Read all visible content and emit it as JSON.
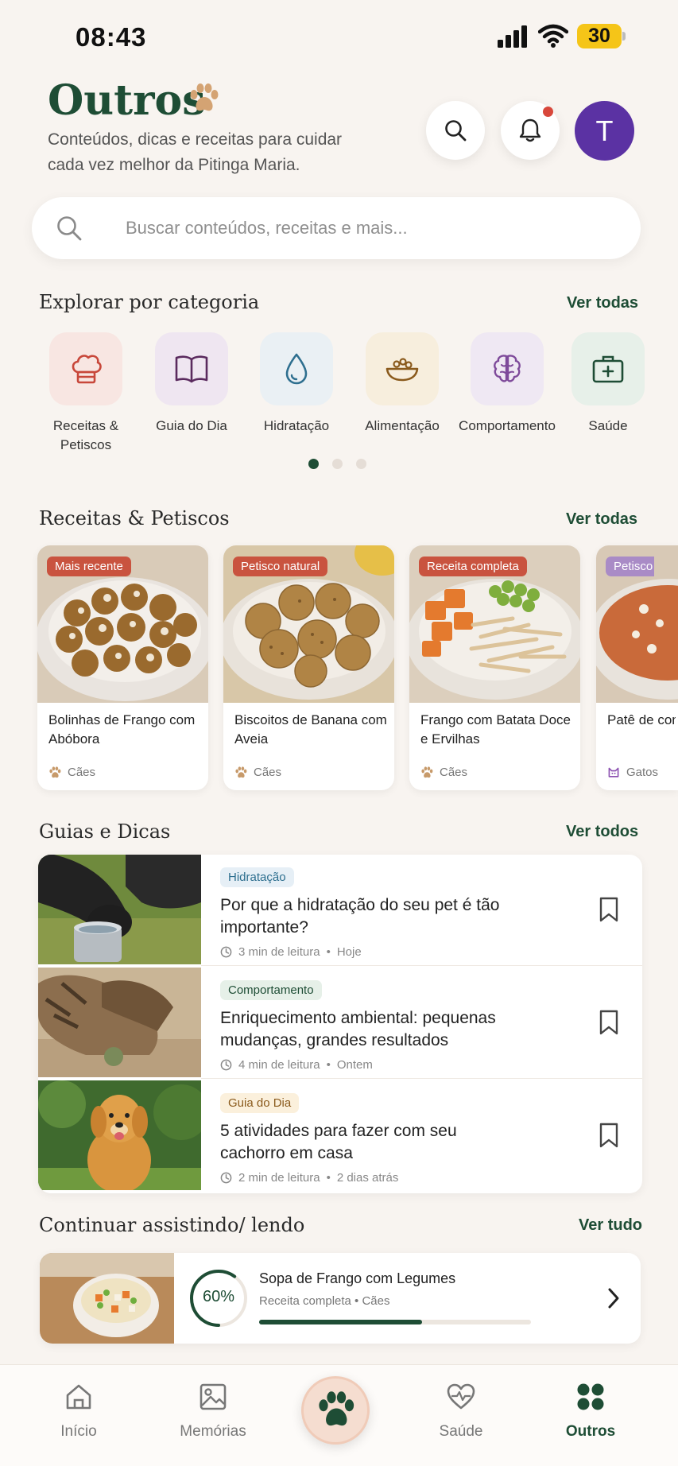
{
  "status": {
    "time": "08:43",
    "battery": "30"
  },
  "header": {
    "title": "Outros",
    "subtitle": "Conteúdos, dicas e receitas para cuidar cada vez melhor da Pitinga Maria.",
    "avatar_letter": "T"
  },
  "search": {
    "placeholder": "Buscar conteúdos, receitas e mais..."
  },
  "categories": {
    "title": "Explorar por categoria",
    "link": "Ver todas",
    "items": [
      {
        "label": "Receitas & Petiscos",
        "icon": "chef-hat-icon"
      },
      {
        "label": "Guia do Dia",
        "icon": "book-icon"
      },
      {
        "label": "Hidratação",
        "icon": "water-drop-icon"
      },
      {
        "label": "Alimentação",
        "icon": "food-bowl-icon"
      },
      {
        "label": "Comportamento",
        "icon": "brain-icon"
      },
      {
        "label": "Saúde",
        "icon": "medical-kit-icon"
      }
    ],
    "page_count": 3,
    "active_page": 1
  },
  "recipes": {
    "title": "Receitas & Petiscos",
    "link": "Ver todas",
    "items": [
      {
        "badge": "Mais recente",
        "name": "Bolinhas de Frango com Abóbora",
        "pet": "Cães"
      },
      {
        "badge": "Petisco natural",
        "name": "Biscoitos de Banana com Aveia",
        "pet": "Cães"
      },
      {
        "badge": "Receita completa",
        "name": "Frango com Batata Doce e Ervilhas",
        "pet": "Cães"
      },
      {
        "badge": "Petisco",
        "name": "Patê de com At",
        "pet": "Gatos"
      }
    ]
  },
  "guides": {
    "title": "Guias e Dicas",
    "link": "Ver todos",
    "items": [
      {
        "tag": "Hidratação",
        "title": "Por que a hidratação do seu pet é tão importante?",
        "read": "3 min de leitura",
        "when": "Hoje"
      },
      {
        "tag": "Comportamento",
        "title": "Enriquecimento ambiental: pequenas mudanças, grandes resultados",
        "read": "4 min de leitura",
        "when": "Ontem"
      },
      {
        "tag": "Guia do Dia",
        "title": "5 atividades para fazer com seu cachorro em casa",
        "read": "2 min de leitura",
        "when": "2 dias atrás"
      }
    ]
  },
  "continue": {
    "title": "Continuar assistindo/ lendo",
    "link": "Ver tudo",
    "item": {
      "title": "Sopa de Frango com Legumes",
      "subtitle": "Receita completa • Cães",
      "progress_label": "60%",
      "progress": 0.6
    }
  },
  "nav": {
    "items": [
      {
        "label": "Início",
        "icon": "home-icon"
      },
      {
        "label": "Memórias",
        "icon": "gallery-icon"
      },
      {
        "label": "",
        "icon": "paw-icon"
      },
      {
        "label": "Saúde",
        "icon": "heart-pulse-icon"
      },
      {
        "label": "Outros",
        "icon": "grid-dots-icon",
        "active": true
      }
    ]
  },
  "colors": {
    "brand": "#1e4d35",
    "accent": "#5b32a3",
    "badge_red": "#c9533f",
    "background": "#f8f4f0"
  }
}
